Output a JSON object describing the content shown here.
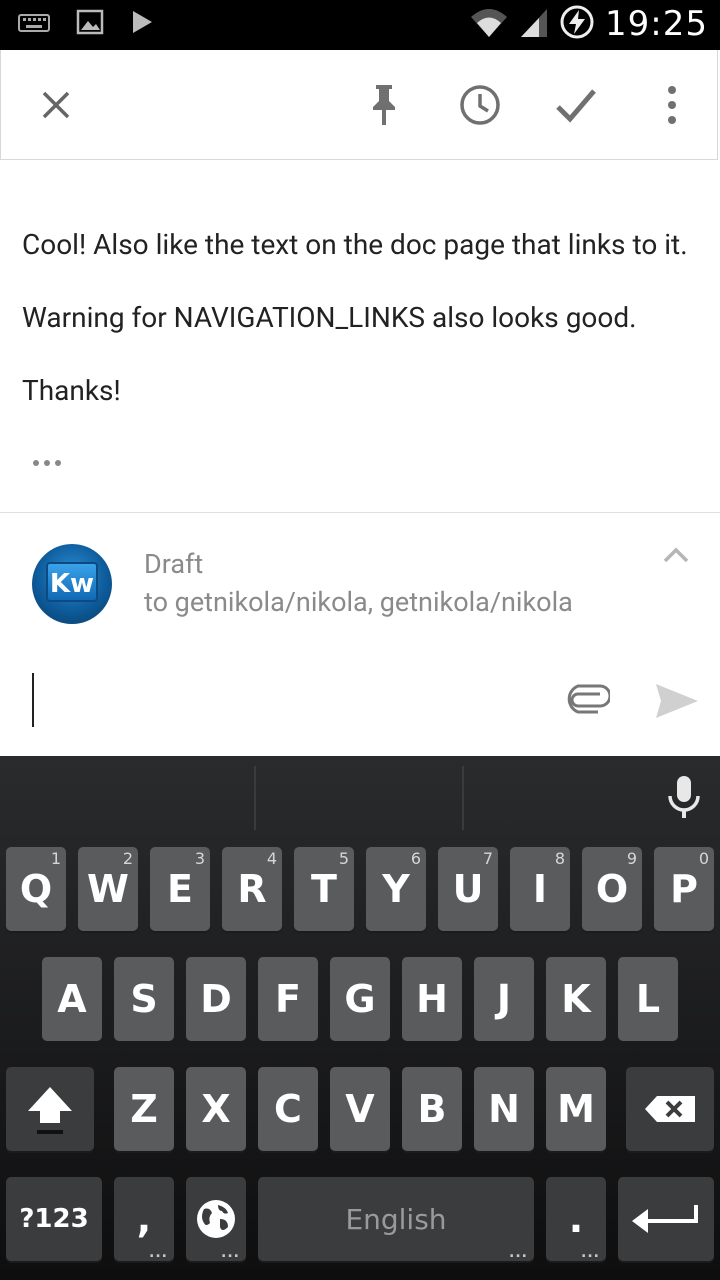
{
  "status_bar": {
    "time": "19:25"
  },
  "toolbar": {
    "close": "close",
    "pin": "pin",
    "snooze": "snooze",
    "done": "done",
    "more": "more options"
  },
  "message": {
    "lines": [
      "Cool! Also like the text on the doc page that links to it.",
      "Warning for NAVIGATION_LINKS also looks good.",
      "Thanks!"
    ]
  },
  "draft": {
    "avatar_text": "Kw",
    "label": "Draft",
    "to": "to getnikola/nikola, getnikola/nikola"
  },
  "keyboard": {
    "row1": [
      {
        "k": "Q",
        "h": "1"
      },
      {
        "k": "W",
        "h": "2"
      },
      {
        "k": "E",
        "h": "3"
      },
      {
        "k": "R",
        "h": "4"
      },
      {
        "k": "T",
        "h": "5"
      },
      {
        "k": "Y",
        "h": "6"
      },
      {
        "k": "U",
        "h": "7"
      },
      {
        "k": "I",
        "h": "8"
      },
      {
        "k": "O",
        "h": "9"
      },
      {
        "k": "P",
        "h": "0"
      }
    ],
    "row2": [
      "A",
      "S",
      "D",
      "F",
      "G",
      "H",
      "J",
      "K",
      "L"
    ],
    "row3": [
      "Z",
      "X",
      "C",
      "V",
      "B",
      "N",
      "M"
    ],
    "symbols_label": "?123",
    "comma_label": ",",
    "space_label": "English",
    "period_label": "."
  }
}
